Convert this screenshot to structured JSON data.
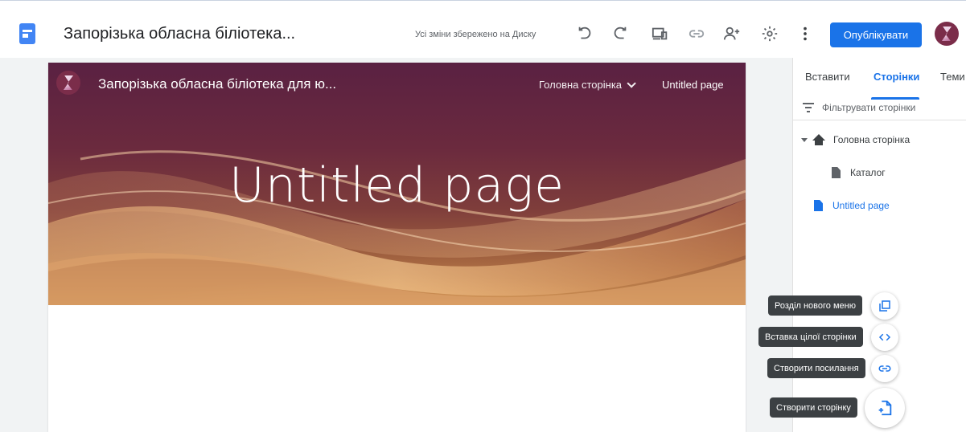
{
  "header": {
    "doc_title": "Запорізька обласна біліотека...",
    "saved_status": "Усі зміни збережено на Диску",
    "publish_label": "Опублікувати",
    "icons": [
      "undo-icon",
      "redo-icon",
      "preview-icon",
      "link-icon",
      "share-icon",
      "settings-icon",
      "more-icon"
    ]
  },
  "site": {
    "name": "Запорізька обласна біліотека для ю...",
    "nav": {
      "home": "Головна сторінка",
      "current": "Untitled page"
    },
    "hero_title": "Untitled page"
  },
  "panel": {
    "tabs": [
      "Вставити",
      "Сторінки",
      "Теми"
    ],
    "active_tab": "Сторінки",
    "filter_placeholder": "Фільтрувати сторінки",
    "tree": {
      "home": "Головна сторінка",
      "catalog": "Каталог",
      "untitled": "Untitled page"
    }
  },
  "fab_menu": {
    "new_menu_section": "Розділ нового меню",
    "embed_full_page": "Вставка цілої сторінки",
    "create_link": "Створити посилання",
    "create_page": "Створити сторінку"
  },
  "colors": {
    "accent": "#1a73e8",
    "tooltip": "#3c4043",
    "hero_top": "#5a2142",
    "hero_bottom": "#c98c4f"
  }
}
